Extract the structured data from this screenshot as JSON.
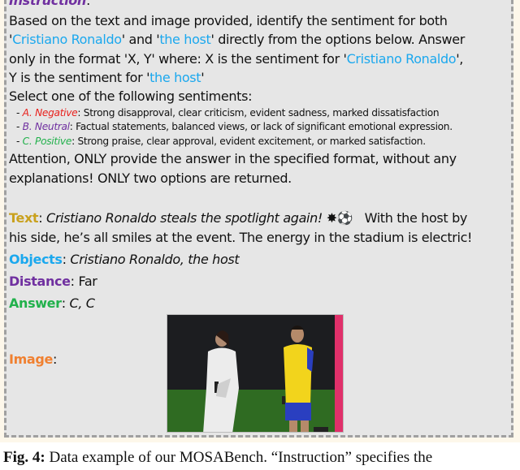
{
  "instruction": {
    "label": "Instruction",
    "colon": ":",
    "l1": "Based on the text and image provided, identify the sentiment for both",
    "l2_q1": "'",
    "l2_e1": "Cristiano Ronaldo",
    "l2_mid": "' and '",
    "l2_e2": "the host",
    "l2_end": "' directly from the options below. Answer",
    "l3_pre": "only in the format 'X, Y' where: X is the sentiment for '",
    "l3_e1": "Cristiano Ronaldo",
    "l3_end": "',",
    "l4_pre": "Y is the sentiment for '",
    "l4_e2": "the host",
    "l4_end": "'",
    "l5": "Select one of the following sentiments:",
    "options": [
      {
        "prefix": "- ",
        "key": "A. Negative",
        "desc": ": Strong disapproval, clear criticism, evident sadness, marked dissatisfaction"
      },
      {
        "prefix": "- ",
        "key": "B. Neutral",
        "desc": ": Factual statements, balanced views, or lack of significant emotional expression."
      },
      {
        "prefix": "- ",
        "key": "C. Positive",
        "desc": ": Strong praise, clear approval, evident excitement, or marked satisfaction."
      }
    ],
    "l6": "Attention, ONLY provide the answer in the specified format, without any",
    "l7": "explanations! ONLY two options are returned."
  },
  "text_field": {
    "label": "Text",
    "colon": ": ",
    "l1": "Cristiano Ronaldo steals the spotlight again! ",
    "emoji": "✸⚽",
    "l1_end": "   With the host by",
    "l2": "his side, he’s all smiles at the event. The energy in the stadium is electric!"
  },
  "objects": {
    "label": "Objects",
    "colon": ": ",
    "value": "Cristiano Ronaldo, the host"
  },
  "distance": {
    "label": "Distance",
    "colon": ": ",
    "value": "Far"
  },
  "answer": {
    "label": "Answer",
    "colon": ": ",
    "value": "C, C"
  },
  "image": {
    "label": "Image",
    "colon": ":",
    "alt": "Host in white coat holding microphone beside Cristiano Ronaldo in yellow and blue jersey on stadium pitch"
  },
  "caption": {
    "fig": "Fig. 4:",
    "text": " Data example of our MOSABench. “Instruction” specifies the"
  },
  "colors": {
    "entity": "#1ba8ee",
    "instruction_label": "#7030a0",
    "text_label": "#c9a11e",
    "objects_label": "#1ba8ee",
    "distance_label": "#7030a0",
    "answer_label": "#22b14c",
    "image_label": "#f08030",
    "negative": "#e8201c",
    "neutral": "#7030a0",
    "positive": "#22b14c",
    "panel_bg": "#e6e6e6"
  }
}
